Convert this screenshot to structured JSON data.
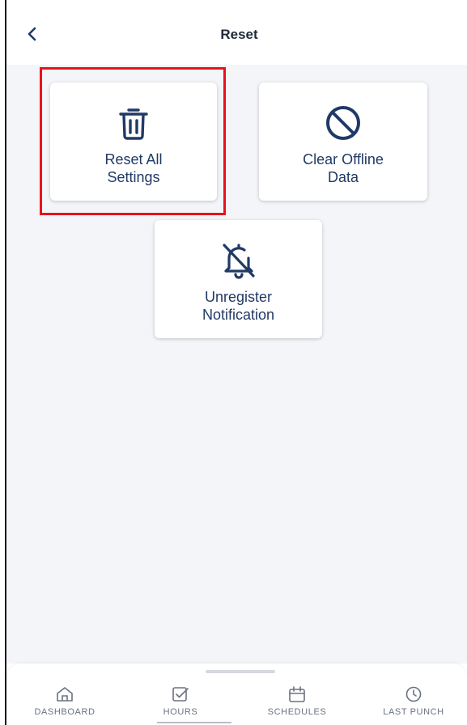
{
  "header": {
    "title": "Reset"
  },
  "cards": [
    {
      "line1": "Reset All",
      "line2": "Settings",
      "icon": "trash-icon"
    },
    {
      "line1": "Clear Offline",
      "line2": "Data",
      "icon": "block-icon"
    },
    {
      "line1": "Unregister",
      "line2": "Notification",
      "icon": "bell-off-icon"
    }
  ],
  "nav": [
    {
      "label": "DASHBOARD",
      "icon": "home-icon"
    },
    {
      "label": "HOURS",
      "icon": "check-square-icon"
    },
    {
      "label": "SCHEDULES",
      "icon": "calendar-icon"
    },
    {
      "label": "LAST PUNCH",
      "icon": "clock-icon"
    }
  ],
  "colors": {
    "accent": "#203a66",
    "highlight": "#e8121c",
    "background": "#f3f5f9"
  }
}
